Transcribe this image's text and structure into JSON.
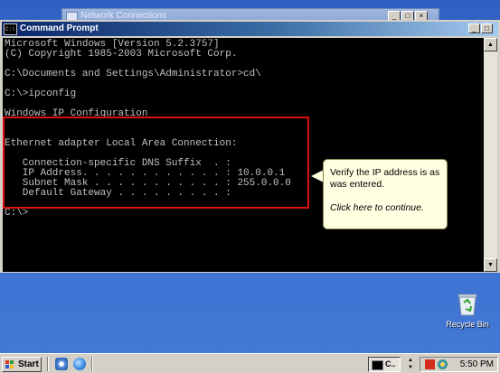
{
  "background_window": {
    "title": "Network Connections"
  },
  "window": {
    "title": "Command Prompt",
    "icon_text": "C:\\",
    "minimize_glyph": "_",
    "maximize_glyph": "□",
    "close_glyph": "×"
  },
  "console": {
    "lines": [
      "Microsoft Windows [Version 5.2.3757]",
      "(C) Copyright 1985-2003 Microsoft Corp.",
      "",
      "C:\\Documents and Settings\\Administrator>cd\\",
      "",
      "C:\\>ipconfig",
      "",
      "Windows IP Configuration",
      "",
      "",
      "Ethernet adapter Local Area Connection:",
      "",
      "   Connection-specific DNS Suffix  . :",
      "   IP Address. . . . . . . . . . . . : 10.0.0.1",
      "   Subnet Mask . . . . . . . . . . . : 255.0.0.0",
      "   Default Gateway . . . . . . . . . :",
      "",
      "C:\\>"
    ]
  },
  "callout": {
    "message": "Verify the IP address is as was entered.",
    "link": "Click here to continue."
  },
  "desktop": {
    "recycle_bin_label": "Recycle Bin"
  },
  "taskbar": {
    "start_label": "Start",
    "task_label": "C..",
    "clock": "5:50 PM"
  },
  "colors": {
    "highlight_border": "#e01010",
    "callout_bg": "#ffffe1",
    "titlebar_start": "#0a246a",
    "console_text": "#c0c0c0"
  }
}
